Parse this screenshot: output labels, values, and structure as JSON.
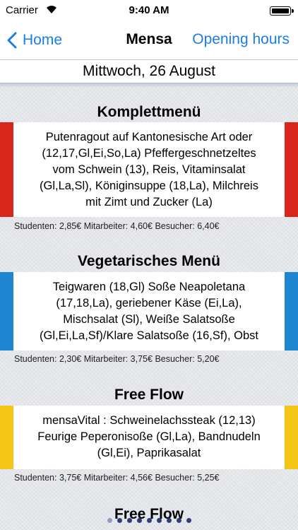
{
  "status_bar": {
    "carrier": "Carrier",
    "time": "9:40 AM"
  },
  "nav": {
    "back_label": "Home",
    "title": "Mensa",
    "right_label": "Opening hours"
  },
  "date_header": "Mittwoch, 26 August",
  "menus": [
    {
      "title": "Komplettmenü",
      "lines": [
        "Putenragout auf Kantonesische Art oder",
        "(12,17,Gl,Ei,So,La) Pfeffergeschnetzeltes",
        "vom Schwein (13), Reis, Vitaminsalat",
        "(Gl,La,Sl), Königinsuppe (18,La), Milchreis",
        "mit Zimt und Zucker (La)"
      ],
      "prices": "Studenten: 2,85€ Mitarbeiter: 4,60€ Besucher: 6,40€",
      "color": "#d9261c"
    },
    {
      "title": "Vegetarisches Menü",
      "lines": [
        "Teigwaren (18,Gl) Soße Neapoletana",
        "(17,18,La), geriebener Käse (Ei,La),",
        "Mischsalat (Sl), Weiße Salatsoße",
        "(Gl,Ei,La,Sf)/Klare Salatsoße (16,Sf), Obst"
      ],
      "prices": "Studenten: 2,30€ Mitarbeiter: 3,75€ Besucher: 5,20€",
      "color": "#1e86d0"
    },
    {
      "title": "Free Flow",
      "lines": [
        "mensaVital : Schweinelachssteak (12,13)",
        "Feurige Peperonisoße (Gl,La), Bandnudeln",
        "(Gl,Ei), Paprikasalat"
      ],
      "prices": "Studenten: 3,75€ Mitarbeiter: 4,56€ Besucher: 5,25€",
      "color": "#f3c517"
    },
    {
      "title": "Free Flow"
    }
  ],
  "page_dots": {
    "count": 9,
    "active_index": 0
  }
}
